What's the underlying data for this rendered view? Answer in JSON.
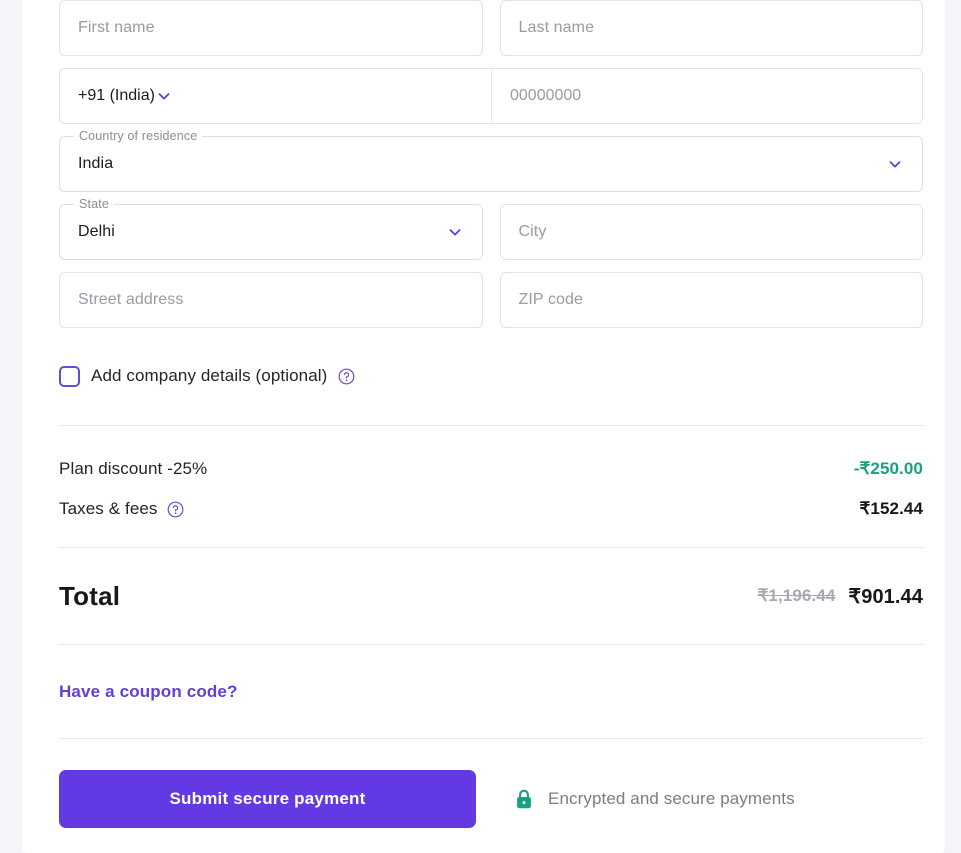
{
  "theme": {
    "page_bg": "#f4f4f9",
    "card_bg": "#ffffff",
    "accent_purple": "#6239e2",
    "link_purple": "#6240d8",
    "checkbox_purple": "#6b4ad1",
    "discount_green": "#17a183",
    "lock_green": "#17a183",
    "text_dark": "#16181d",
    "text_muted": "#7c7c89",
    "placeholder": "#9a9aa5",
    "border": "#e2e2e8"
  },
  "form": {
    "first_name": {
      "placeholder": "First name",
      "value": ""
    },
    "last_name": {
      "placeholder": "Last name",
      "value": ""
    },
    "country_code": {
      "value": "+91 (India)",
      "icon": "chevron-down-icon"
    },
    "phone": {
      "placeholder": "00000000",
      "value": ""
    },
    "country_of_residence": {
      "label": "Country of residence",
      "value": "India",
      "icon": "chevron-down-icon"
    },
    "state": {
      "label": "State",
      "value": "Delhi",
      "icon": "chevron-down-icon"
    },
    "city": {
      "placeholder": "City",
      "value": ""
    },
    "street_address": {
      "placeholder": "Street address",
      "value": ""
    },
    "zip_code": {
      "placeholder": "ZIP code",
      "value": ""
    },
    "company_checkbox": {
      "label": "Add company details (optional)",
      "checked": false,
      "help_icon": "question-circle-icon"
    }
  },
  "summary": {
    "rows": [
      {
        "label": "Plan discount -25%",
        "value": "-₹250.00",
        "style": "discount",
        "help_icon": ""
      },
      {
        "label": "Taxes & fees",
        "value": "₹152.44",
        "style": "normal",
        "help_icon": "question-circle-icon"
      }
    ],
    "total": {
      "label": "Total",
      "original_price": "₹1,196.44",
      "final_price": "₹901.44"
    },
    "coupon_link": "Have a coupon code?"
  },
  "footer": {
    "submit_label": "Submit secure payment",
    "secure_text": "Encrypted and secure payments",
    "lock_icon": "lock-icon"
  }
}
